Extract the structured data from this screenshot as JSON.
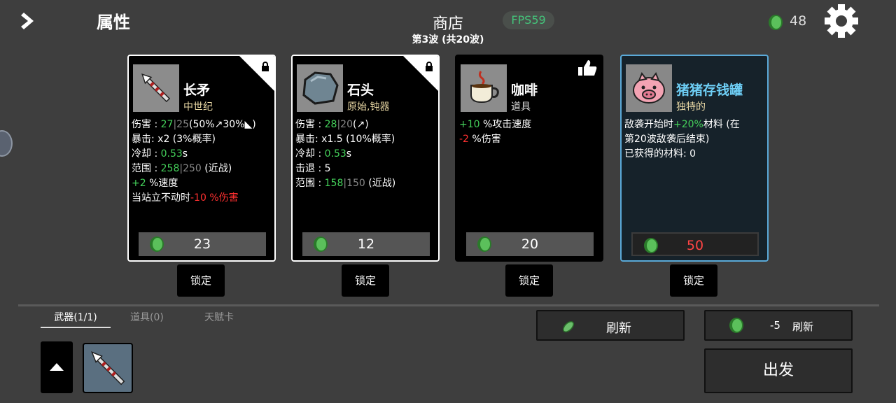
{
  "header": {
    "attributes_title": "属性",
    "shop_title": "商店",
    "wave": "第3波 (共20波)",
    "fps": "FPS59",
    "materials": "48"
  },
  "cards": [
    {
      "name": "长矛",
      "type": "中世纪",
      "price": "23",
      "stat_lines": [
        [
          [
            "伤害 : ",
            ""
          ],
          [
            "27",
            "g"
          ],
          [
            "|25",
            "gr"
          ],
          [
            "(50%",
            ""
          ],
          [
            "↗",
            ""
          ],
          [
            "30%",
            ""
          ],
          [
            "◣",
            ""
          ],
          [
            ")",
            ""
          ]
        ],
        [
          [
            "暴击:  x2 (3%概率)",
            ""
          ]
        ],
        [
          [
            "冷却 : ",
            ""
          ],
          [
            "0.53",
            "g"
          ],
          [
            "s",
            ""
          ]
        ],
        [
          [
            "范围 : ",
            ""
          ],
          [
            "258",
            "g"
          ],
          [
            "|250",
            "gr"
          ],
          [
            " (近战)",
            ""
          ]
        ],
        [
          [
            "+2",
            "g"
          ],
          [
            " %速度",
            ""
          ]
        ],
        [
          [
            "当站立不动时",
            ""
          ],
          [
            "-10 %伤害",
            "r"
          ]
        ]
      ]
    },
    {
      "name": "石头",
      "type": "原始,钝器",
      "price": "12",
      "stat_lines": [
        [
          [
            "伤害 : ",
            ""
          ],
          [
            "28",
            "g"
          ],
          [
            "|20",
            "gr"
          ],
          [
            "(",
            ""
          ],
          [
            "↗",
            ""
          ],
          [
            ")",
            ""
          ]
        ],
        [
          [
            "暴击:  x1.5 (10%概率)",
            ""
          ]
        ],
        [
          [
            "冷却 : ",
            ""
          ],
          [
            "0.53",
            "g"
          ],
          [
            "s",
            ""
          ]
        ],
        [
          [
            "击退 : 5",
            ""
          ]
        ],
        [
          [
            "范围 : ",
            ""
          ],
          [
            "158",
            "g"
          ],
          [
            "|150",
            "gr"
          ],
          [
            " (近战)",
            ""
          ]
        ]
      ]
    },
    {
      "name": "咖啡",
      "type": "道具",
      "price": "20",
      "stat_lines": [
        [
          [
            "+10",
            "g"
          ],
          [
            " %攻击速度",
            ""
          ]
        ],
        [
          [
            "-2",
            "r"
          ],
          [
            " %伤害",
            ""
          ]
        ]
      ]
    },
    {
      "name": "猪猪存钱罐",
      "type": "独特的",
      "price": "50",
      "stat_lines": [
        [
          [
            "敌袭开始时",
            ""
          ],
          [
            "+20%",
            "g"
          ],
          [
            "材料 (在",
            ""
          ]
        ],
        [
          [
            "第20波敌袭后结束)",
            ""
          ]
        ],
        [
          [
            "已获得的材料:  0",
            ""
          ]
        ]
      ]
    }
  ],
  "lock_label": "锁定",
  "bottom": {
    "tabs": [
      "武器(1/1)",
      "道具(0)",
      "天赋卡"
    ],
    "refresh": "刷新",
    "refresh_cost": "-5",
    "refresh_paid_label": "刷新",
    "go": "出发"
  },
  "colors": {
    "green": "#44d15a",
    "red": "#ff3030",
    "blue_name": "#6ecff6",
    "fps": "#44c47a"
  },
  "icons": [
    "chevron-right-icon",
    "gear-icon",
    "coin-icon",
    "lock-icon",
    "thumbs-up-icon",
    "spear-icon",
    "rock-icon",
    "coffee-icon",
    "piggy-bank-icon",
    "up-arrow-icon",
    "leaf-coin-icon"
  ]
}
